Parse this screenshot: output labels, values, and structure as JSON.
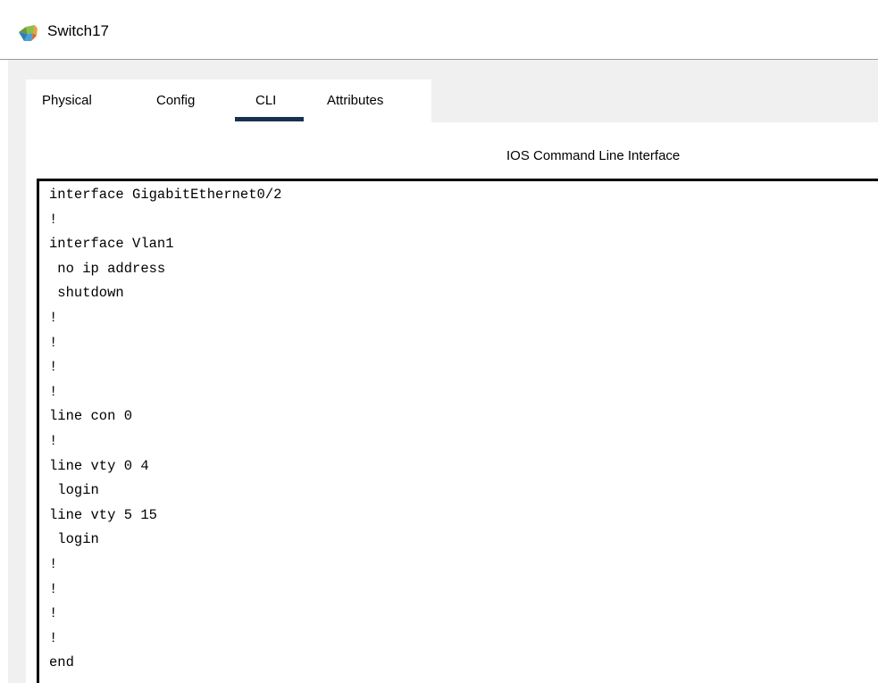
{
  "window": {
    "title": "Switch17",
    "icon": "cisco-device-icon"
  },
  "tabs": [
    {
      "label": "Physical",
      "active": false
    },
    {
      "label": "Config",
      "active": false
    },
    {
      "label": "CLI",
      "active": true
    },
    {
      "label": "Attributes",
      "active": false
    }
  ],
  "cli": {
    "heading": "IOS Command Line Interface",
    "lines": [
      "interface GigabitEthernet0/2",
      "!",
      "interface Vlan1",
      " no ip address",
      " shutdown",
      "!",
      "!",
      "!",
      "!",
      "line con 0",
      "!",
      "line vty 0 4",
      " login",
      "line vty 5 15",
      " login",
      "!",
      "!",
      "!",
      "!",
      "end"
    ]
  },
  "colors": {
    "active_tab_indicator": "#17324d",
    "background": "#f0f0f0",
    "panel": "#ffffff",
    "terminal_border": "#000000"
  }
}
